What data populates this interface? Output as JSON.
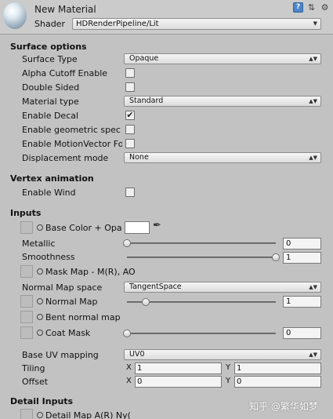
{
  "header": {
    "material_name": "New Material",
    "shader_label": "Shader",
    "shader_value": "HDRenderPipeline/Lit",
    "icons": [
      "help-icon",
      "preset-icon",
      "settings-gear-icon"
    ]
  },
  "surface_options": {
    "title": "Surface options",
    "surface_type": {
      "label": "Surface Type",
      "value": "Opaque"
    },
    "alpha_cutoff": {
      "label": "Alpha Cutoff Enable",
      "checked": false
    },
    "double_sided": {
      "label": "Double Sided",
      "checked": false
    },
    "material_type": {
      "label": "Material type",
      "value": "Standard"
    },
    "enable_decal": {
      "label": "Enable Decal",
      "checked": true
    },
    "geometric_spec": {
      "label": "Enable geometric spec",
      "checked": false
    },
    "motion_vector": {
      "label": "Enable MotionVector Fo",
      "checked": false
    },
    "displacement_mode": {
      "label": "Displacement mode",
      "value": "None"
    }
  },
  "vertex_animation": {
    "title": "Vertex animation",
    "enable_wind": {
      "label": "Enable Wind",
      "checked": false
    }
  },
  "inputs": {
    "title": "Inputs",
    "base_color": {
      "label": "Base Color + Opa",
      "color": "#ffffff"
    },
    "metallic": {
      "label": "Metallic",
      "value": "0",
      "fraction": 0.0
    },
    "smoothness": {
      "label": "Smoothness",
      "value": "1",
      "fraction": 1.0
    },
    "mask_map": {
      "label": "Mask Map - M(R), AO"
    },
    "normal_map_space": {
      "label": "Normal Map space",
      "value": "TangentSpace"
    },
    "normal_map": {
      "label": "Normal Map",
      "value": "1",
      "fraction": 0.125
    },
    "bent_normal_map": {
      "label": "Bent normal map"
    },
    "coat_mask": {
      "label": "Coat Mask",
      "value": "0",
      "fraction": 0.0
    },
    "base_uv_mapping": {
      "label": "Base UV mapping",
      "value": "UV0"
    },
    "tiling": {
      "label": "Tiling",
      "x_label": "X",
      "x": "1",
      "y_label": "Y",
      "y": "1"
    },
    "offset": {
      "label": "Offset",
      "x_label": "X",
      "x": "0",
      "y_label": "Y",
      "y": "0"
    }
  },
  "detail_inputs": {
    "title": "Detail Inputs",
    "detail_map": {
      "label": "Detail Map A(R) Ny("
    }
  },
  "watermark": "知乎 @繁华如梦"
}
